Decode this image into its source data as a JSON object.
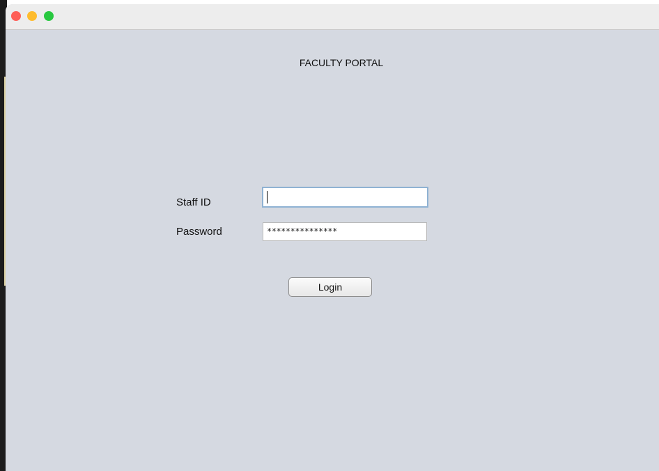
{
  "window": {
    "controls": {
      "close_color": "#fe5f57",
      "minimize_color": "#febc2e",
      "zoom_color": "#28c840"
    }
  },
  "portal": {
    "title": "FACULTY PORTAL"
  },
  "form": {
    "staff_id_label": "Staff ID",
    "staff_id_value": "",
    "password_label": "Password",
    "password_masked": "***************"
  },
  "actions": {
    "login_label": "Login"
  }
}
